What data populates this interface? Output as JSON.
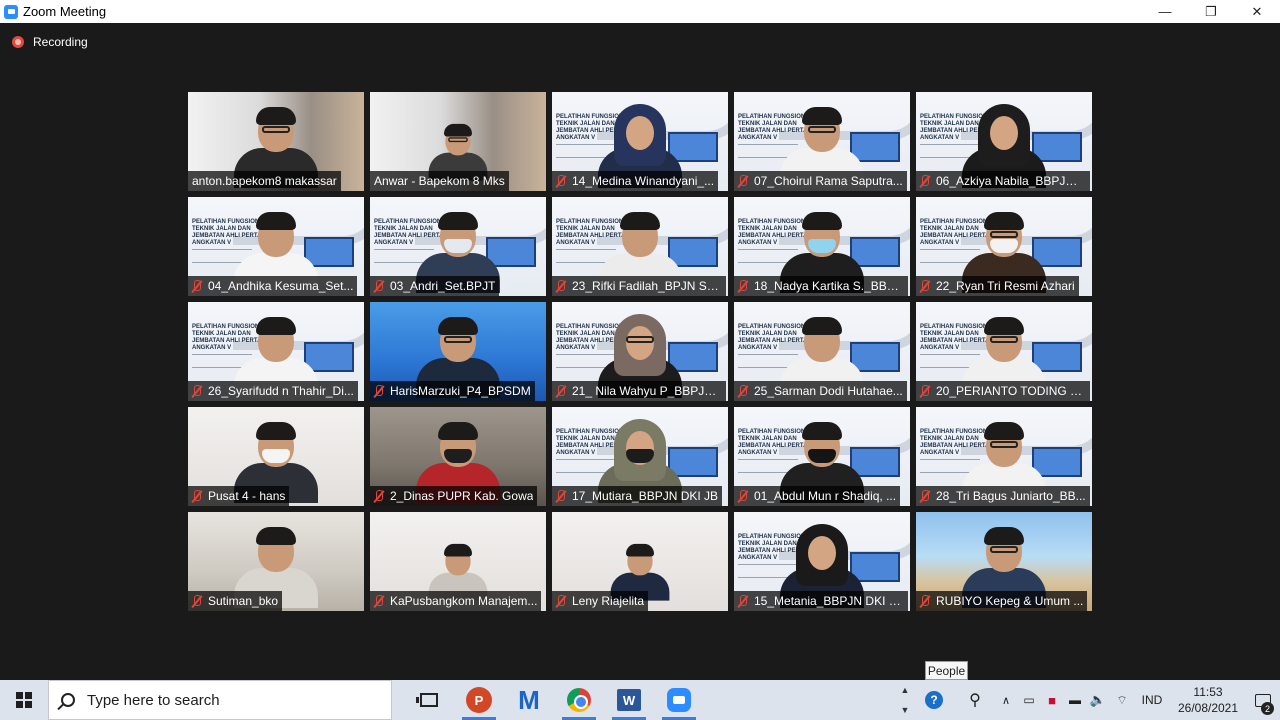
{
  "window": {
    "title": "Zoom Meeting",
    "minimize": "—",
    "maximize": "❐",
    "close": "✕"
  },
  "recording": {
    "label": "Recording"
  },
  "participants": [
    {
      "name": "anton.bapekom8 makassar",
      "muted": false,
      "bg": "bg-city",
      "person": {
        "body": "#2a2a2a",
        "hair": true,
        "glasses": true
      }
    },
    {
      "name": "Anwar - Bapekom 8 Mks",
      "muted": false,
      "bg": "bg-city",
      "person": {
        "body": "#3b3b3b",
        "hair": true,
        "glasses": true,
        "small": true
      }
    },
    {
      "name": "14_Medina Winandyani_...",
      "muted": true,
      "bg": "bg-slide",
      "person": {
        "body": "#222d4a",
        "hijab": "#26345e"
      }
    },
    {
      "name": "07_Choirul Rama Saputra...",
      "muted": true,
      "bg": "bg-slide",
      "person": {
        "body": "#f2f2f2",
        "hair": true,
        "glasses": true
      }
    },
    {
      "name": "06_Azkiya Nabila_BBPJN J...",
      "muted": true,
      "bg": "bg-slide",
      "person": {
        "body": "#1b1b1b",
        "hijab": "#1d1d1d"
      }
    },
    {
      "name": "04_Andhika Kesuma_Set...",
      "muted": true,
      "bg": "bg-slide",
      "person": {
        "body": "#f5f5f5",
        "hair": true
      }
    },
    {
      "name": "03_Andri_Set.BPJT",
      "muted": true,
      "bg": "bg-slide",
      "person": {
        "body": "#2f3e55",
        "hair": true,
        "mask": "#e4e8ef"
      }
    },
    {
      "name": "23_Rifki Fadilah_BPJN Sul...",
      "muted": true,
      "bg": "bg-slide",
      "person": {
        "body": "#ececec",
        "hair": true
      }
    },
    {
      "name": "18_Nadya Kartika S._BBPJ...",
      "muted": true,
      "bg": "bg-slide",
      "person": {
        "body": "#1e1e1e",
        "hair": true,
        "mask": "#8fd3ef"
      }
    },
    {
      "name": "22_Ryan Tri Resmi Azhari",
      "muted": true,
      "bg": "bg-slide",
      "person": {
        "body": "#3a2a20",
        "hair": true,
        "mask": "#f2f2f2",
        "glasses": true
      }
    },
    {
      "name": "26_Syarifudd n Thahir_Di...",
      "muted": true,
      "bg": "bg-slide",
      "person": {
        "body": "#f4f4f4",
        "hair": true
      }
    },
    {
      "name": "HarisMarzuki_P4_BPSDM",
      "muted": true,
      "bg": "bg-blue",
      "person": {
        "body": "#1d2a3e",
        "hair": true,
        "glasses": true
      }
    },
    {
      "name": "21_ Nila Wahyu P_BBPJN ...",
      "muted": true,
      "bg": "bg-slide",
      "person": {
        "body": "#1c1c1c",
        "hijab": "#7a6a62",
        "glasses": true
      }
    },
    {
      "name": "25_Sarman Dodi Hutahae...",
      "muted": true,
      "bg": "bg-slide",
      "person": {
        "body": "#f1f1f1",
        "hair": true
      }
    },
    {
      "name": "20_PERIANTO TODING LA...",
      "muted": true,
      "bg": "bg-slide",
      "person": {
        "body": "#f0f0f0",
        "hair": true,
        "glasses": true
      }
    },
    {
      "name": "Pusat 4 - hans",
      "muted": true,
      "bg": "bg-white",
      "person": {
        "body": "#2c2f36",
        "hair": true,
        "mask": "#f4f4f4"
      }
    },
    {
      "name": "2_Dinas PUPR Kab. Gowa",
      "muted": true,
      "bg": "bg-office",
      "person": {
        "body": "#b5262a",
        "hair": true,
        "mask": "#1e1e1e"
      }
    },
    {
      "name": "17_Mutiara_BBPJN DKI JB",
      "muted": true,
      "bg": "bg-slide",
      "person": {
        "body": "#6b6d58",
        "hijab": "#7b7a64",
        "mask": "#1c1c1c"
      }
    },
    {
      "name": "01_Abdul Mun r Shadiq, ...",
      "muted": true,
      "bg": "bg-slide",
      "person": {
        "body": "#202020",
        "hair": true,
        "mask": "#151515"
      }
    },
    {
      "name": "28_Tri Bagus Juniarto_BB...",
      "muted": true,
      "bg": "bg-slide",
      "person": {
        "body": "#f2f2f2",
        "hair": true,
        "glasses": true
      }
    },
    {
      "name": "Sutiman_bko",
      "muted": true,
      "bg": "bg-room",
      "person": {
        "body": "#d9d6cf",
        "hair": true
      }
    },
    {
      "name": "KaPusbangkom Manajem...",
      "muted": true,
      "bg": "bg-white",
      "person": {
        "body": "#c9c4bd",
        "hair": true,
        "small": true
      }
    },
    {
      "name": "Leny Riajelita",
      "muted": true,
      "bg": "bg-white",
      "person": {
        "body": "#1f2940",
        "hair": true,
        "small": true
      }
    },
    {
      "name": "15_Metania_BBPJN DKI Ja...",
      "muted": true,
      "bg": "bg-slide",
      "person": {
        "body": "#1c2233",
        "hijab": "#1a1a1a"
      }
    },
    {
      "name": "RUBIYO Kepeg & Umum ...",
      "muted": true,
      "bg": "bg-beach",
      "person": {
        "body": "#2b3b5a",
        "hair": true,
        "glasses": true
      }
    }
  ],
  "slide": {
    "text": "PELATIHAN FUNGSIONAL TEKNIK JALAN DAN JEMBATAN AHLI PERTAMA ANGKATAN V"
  },
  "tooltip": {
    "label": "People"
  },
  "taskbar": {
    "search_placeholder": "Type here to search",
    "apps": [
      {
        "name": "task-view",
        "icon": "taskview-icon"
      },
      {
        "name": "powerpoint",
        "icon": "powerpoint-icon",
        "label": "P"
      },
      {
        "name": "malwarebytes",
        "icon": "malwarebytes-icon",
        "label": "M"
      },
      {
        "name": "chrome",
        "icon": "chrome-icon"
      },
      {
        "name": "word",
        "icon": "word-icon",
        "label": "W"
      },
      {
        "name": "zoom",
        "icon": "zoom-icon"
      }
    ],
    "tray": {
      "language": "IND",
      "time": "11:53",
      "date": "26/08/2021",
      "notification_count": "2",
      "help": "?"
    }
  }
}
